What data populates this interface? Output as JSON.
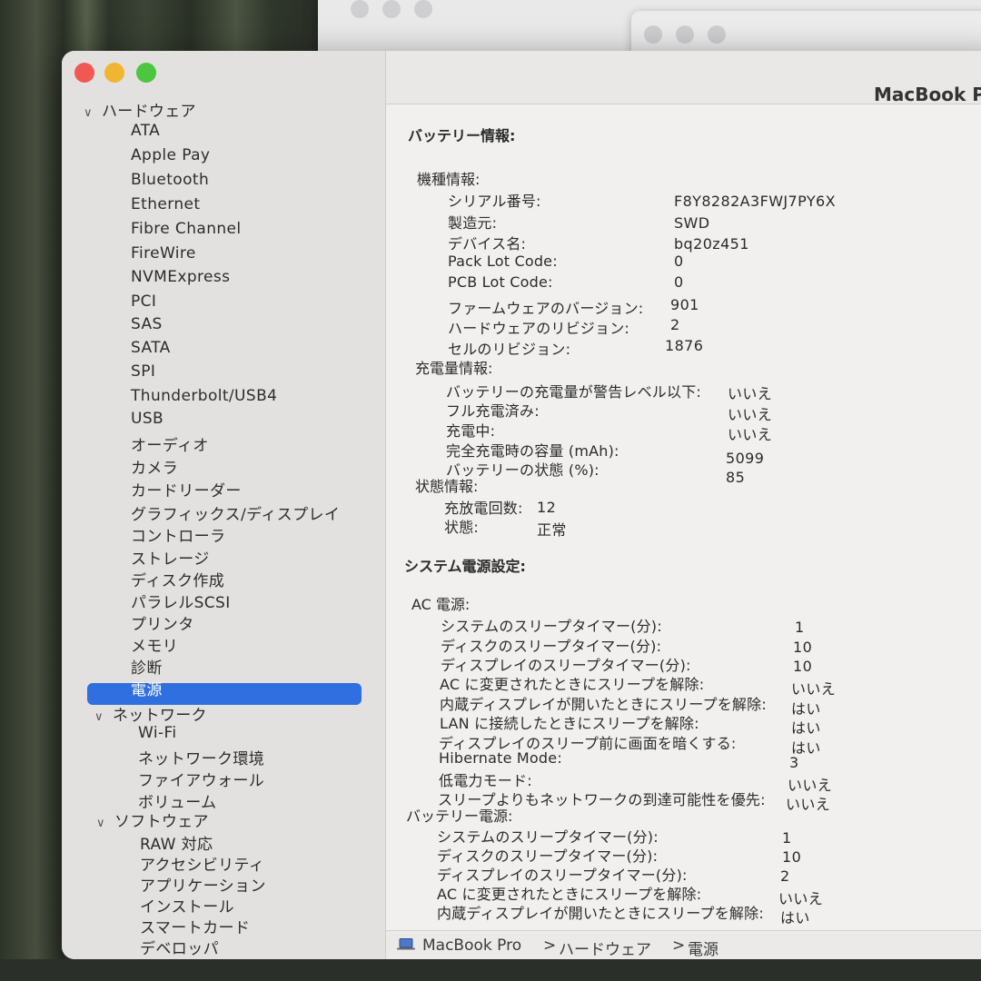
{
  "window_title": "MacBook Pro",
  "sidebar": {
    "sections": [
      {
        "label": "ハードウェア",
        "items": [
          "ATA",
          "Apple Pay",
          "Bluetooth",
          "Ethernet",
          "Fibre Channel",
          "FireWire",
          "NVMExpress",
          "PCI",
          "SAS",
          "SATA",
          "SPI",
          "Thunderbolt/USB4",
          "USB",
          "オーディオ",
          "カメラ",
          "カードリーダー",
          "グラフィックス/ディスプレイ",
          "コントローラ",
          "ストレージ",
          "ディスク作成",
          "パラレルSCSI",
          "プリンタ",
          "メモリ",
          "診断",
          "電源"
        ]
      },
      {
        "label": "ネットワーク",
        "items": [
          "Wi-Fi",
          "ネットワーク環境",
          "ファイアウォール",
          "ボリューム"
        ]
      },
      {
        "label": "ソフトウェア",
        "items": [
          "RAW 対応",
          "アクセシビリティ",
          "アプリケーション",
          "インストール",
          "スマートカード",
          "デベロッパ"
        ]
      }
    ],
    "selected": "電源"
  },
  "battery": {
    "title": "バッテリー情報:",
    "model_info": {
      "label": "機種情報:",
      "rows": [
        {
          "k": "シリアル番号:",
          "v": "F8Y8282A3FWJ7PY6X"
        },
        {
          "k": "製造元:",
          "v": "SWD"
        },
        {
          "k": "デバイス名:",
          "v": "bq20z451"
        },
        {
          "k": "Pack Lot Code:",
          "v": "0"
        },
        {
          "k": "PCB Lot Code:",
          "v": "0"
        },
        {
          "k": "ファームウェアのバージョン:",
          "v": "901"
        },
        {
          "k": "ハードウェアのリビジョン:",
          "v": "2"
        },
        {
          "k": "セルのリビジョン:",
          "v": "1876"
        }
      ]
    },
    "charge_info": {
      "label": "充電量情報:",
      "rows": [
        {
          "k": "バッテリーの充電量が警告レベル以下:",
          "v": "いいえ"
        },
        {
          "k": "フル充電済み:",
          "v": "いいえ"
        },
        {
          "k": "充電中:",
          "v": "いいえ"
        },
        {
          "k": "完全充電時の容量 (mAh):",
          "v": "5099"
        },
        {
          "k": "バッテリーの状態 (%):",
          "v": "85"
        }
      ]
    },
    "status_info": {
      "label": "状態情報:",
      "rows": [
        {
          "k": "充放電回数:",
          "v": "12"
        },
        {
          "k": "状態:",
          "v": "正常"
        }
      ]
    }
  },
  "power": {
    "title": "システム電源設定:",
    "ac": {
      "label": "AC 電源:",
      "rows": [
        {
          "k": "システムのスリープタイマー(分):",
          "v": "1"
        },
        {
          "k": "ディスクのスリープタイマー(分):",
          "v": "10"
        },
        {
          "k": "ディスプレイのスリープタイマー(分):",
          "v": "10"
        },
        {
          "k": "AC に変更されたときにスリープを解除:",
          "v": "いいえ"
        },
        {
          "k": "内蔵ディスプレイが開いたときにスリープを解除:",
          "v": "はい"
        },
        {
          "k": "LAN に接続したときにスリープを解除:",
          "v": "はい"
        },
        {
          "k": "ディスプレイのスリープ前に画面を暗くする:",
          "v": "はい"
        },
        {
          "k": "Hibernate Mode:",
          "v": "3"
        },
        {
          "k": "低電力モード:",
          "v": "いいえ"
        },
        {
          "k": "スリープよりもネットワークの到達可能性を優先:",
          "v": "いいえ"
        }
      ]
    },
    "battery_power": {
      "label": "バッテリー電源:",
      "rows": [
        {
          "k": "システムのスリープタイマー(分):",
          "v": "1"
        },
        {
          "k": "ディスクのスリープタイマー(分):",
          "v": "10"
        },
        {
          "k": "ディスプレイのスリープタイマー(分):",
          "v": "2"
        },
        {
          "k": "AC に変更されたときにスリープを解除:",
          "v": "いいえ"
        },
        {
          "k": "内蔵ディスプレイが開いたときにスリープを解除:",
          "v": "はい"
        }
      ]
    }
  },
  "pathbar": {
    "items": [
      "MacBook Pro",
      "ハードウェア",
      "電源"
    ],
    "separator": ">"
  }
}
